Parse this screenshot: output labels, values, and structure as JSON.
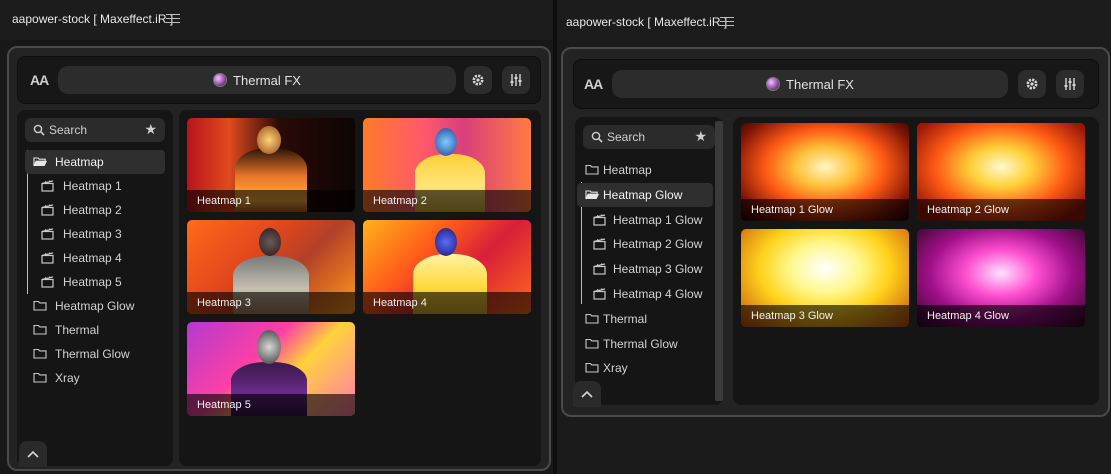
{
  "colors": {
    "accent_guide": "#e1c23a",
    "frame_border": "#4a4a4a",
    "panel_bg": "#232323"
  },
  "panels": [
    {
      "tab_title": "aapower-stock [ Maxeffect.iR ]",
      "toolbar": {
        "aa_label": "AA",
        "title": "Thermal FX",
        "settings_icon": "gear-icon",
        "adjust_icon": "sliders-icon"
      },
      "search": {
        "placeholder": "Search",
        "fav_icon": "star-icon"
      },
      "tree": [
        {
          "label": "Heatmap",
          "type": "folder-open",
          "active": true
        },
        {
          "label": "Heatmap 1",
          "type": "clip"
        },
        {
          "label": "Heatmap 2",
          "type": "clip"
        },
        {
          "label": "Heatmap 3",
          "type": "clip"
        },
        {
          "label": "Heatmap 4",
          "type": "clip"
        },
        {
          "label": "Heatmap 5",
          "type": "clip"
        },
        {
          "label": "Heatmap Glow",
          "type": "folder"
        },
        {
          "label": "Thermal",
          "type": "folder"
        },
        {
          "label": "Thermal Glow",
          "type": "folder"
        },
        {
          "label": "Xray",
          "type": "folder"
        }
      ],
      "thumbs": [
        {
          "caption": "Heatmap 1"
        },
        {
          "caption": "Heatmap 2"
        },
        {
          "caption": "Heatmap 3"
        },
        {
          "caption": "Heatmap 4"
        },
        {
          "caption": "Heatmap 5"
        }
      ]
    },
    {
      "tab_title": "aapower-stock [ Maxeffect.iR ]",
      "toolbar": {
        "aa_label": "AA",
        "title": "Thermal FX",
        "settings_icon": "gear-icon",
        "adjust_icon": "sliders-icon"
      },
      "search": {
        "placeholder": "Search",
        "fav_icon": "star-icon"
      },
      "tree": [
        {
          "label": "Heatmap",
          "type": "folder"
        },
        {
          "label": "Heatmap Glow",
          "type": "folder-open",
          "active": true
        },
        {
          "label": "Heatmap 1 Glow",
          "type": "clip"
        },
        {
          "label": "Heatmap 2 Glow",
          "type": "clip"
        },
        {
          "label": "Heatmap 3 Glow",
          "type": "clip"
        },
        {
          "label": "Heatmap 4 Glow",
          "type": "clip"
        },
        {
          "label": "Thermal",
          "type": "folder"
        },
        {
          "label": "Thermal Glow",
          "type": "folder"
        },
        {
          "label": "Xray",
          "type": "folder"
        }
      ],
      "thumbs": [
        {
          "caption": "Heatmap 1 Glow"
        },
        {
          "caption": "Heatmap 2 Glow"
        },
        {
          "caption": "Heatmap 3 Glow"
        },
        {
          "caption": "Heatmap 4 Glow"
        }
      ]
    }
  ]
}
